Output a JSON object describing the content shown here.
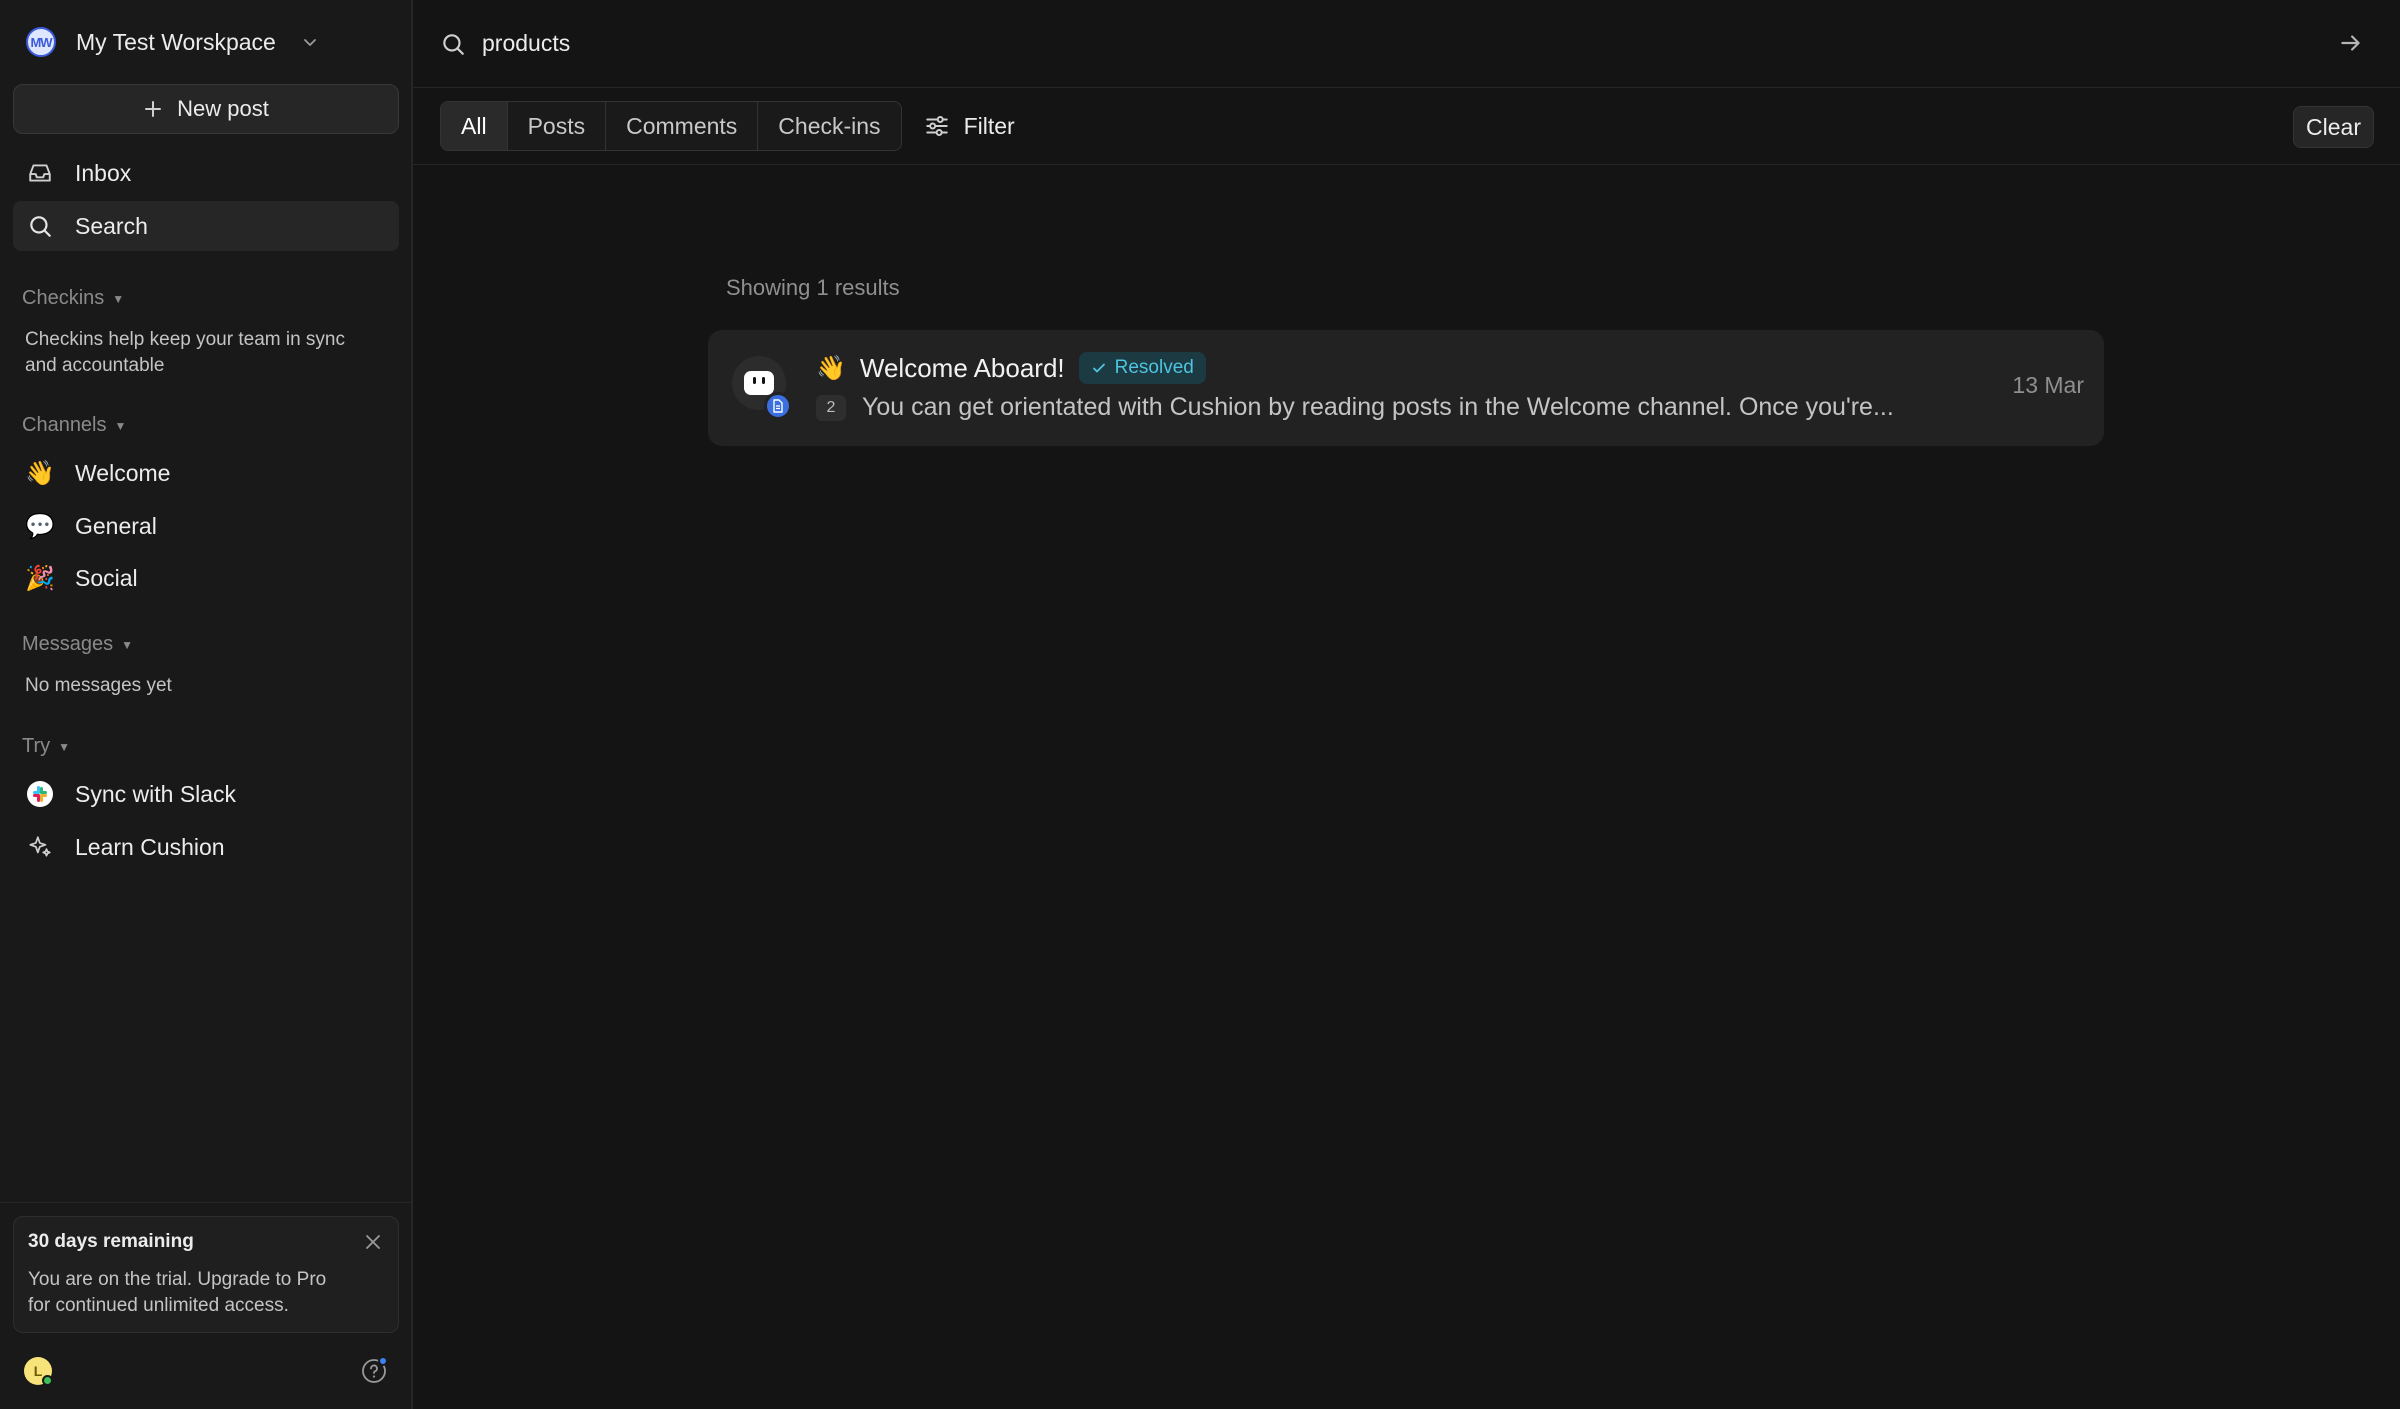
{
  "workspace": {
    "name": "My Test Worskpace",
    "initials": "MW"
  },
  "sidebar": {
    "new_post_label": "New post",
    "nav": [
      {
        "label": "Inbox",
        "icon": "inbox-icon"
      },
      {
        "label": "Search",
        "icon": "search-icon",
        "active": true
      }
    ],
    "checkins": {
      "title": "Checkins",
      "text_line1": "Checkins help keep your team in sync",
      "text_line2": "and accountable"
    },
    "channels": {
      "title": "Channels",
      "items": [
        {
          "label": "Welcome",
          "emoji": "👋"
        },
        {
          "label": "General",
          "emoji": "💬"
        },
        {
          "label": "Social",
          "emoji": "🎉"
        }
      ]
    },
    "messages": {
      "title": "Messages",
      "empty_text": "No messages yet"
    },
    "try": {
      "title": "Try",
      "items": [
        {
          "label": "Sync with Slack",
          "icon": "slack-icon"
        },
        {
          "label": "Learn Cushion",
          "icon": "sparkle-icon"
        }
      ]
    },
    "trial": {
      "title": "30 days remaining",
      "body_line1": "You are on the trial. Upgrade to Pro",
      "body_line2": "for continued unlimited access."
    },
    "user": {
      "initial": "L"
    }
  },
  "search": {
    "query": "products"
  },
  "filters": {
    "tabs": [
      "All",
      "Posts",
      "Comments",
      "Check-ins"
    ],
    "active_tab": "All",
    "filter_label": "Filter",
    "clear_label": "Clear"
  },
  "results": {
    "count_text": "Showing 1 results",
    "items": [
      {
        "emoji": "👋",
        "title": "Welcome Aboard!",
        "status": "Resolved",
        "reply_count": "2",
        "excerpt": "You can get orientated with Cushion by reading posts in the Welcome channel. Once you're...",
        "date": "13 Mar"
      }
    ]
  },
  "colors": {
    "accent": "#3b6fe0",
    "resolved": "#4fc3e0",
    "background": "#141414",
    "sidebar": "#191919"
  }
}
